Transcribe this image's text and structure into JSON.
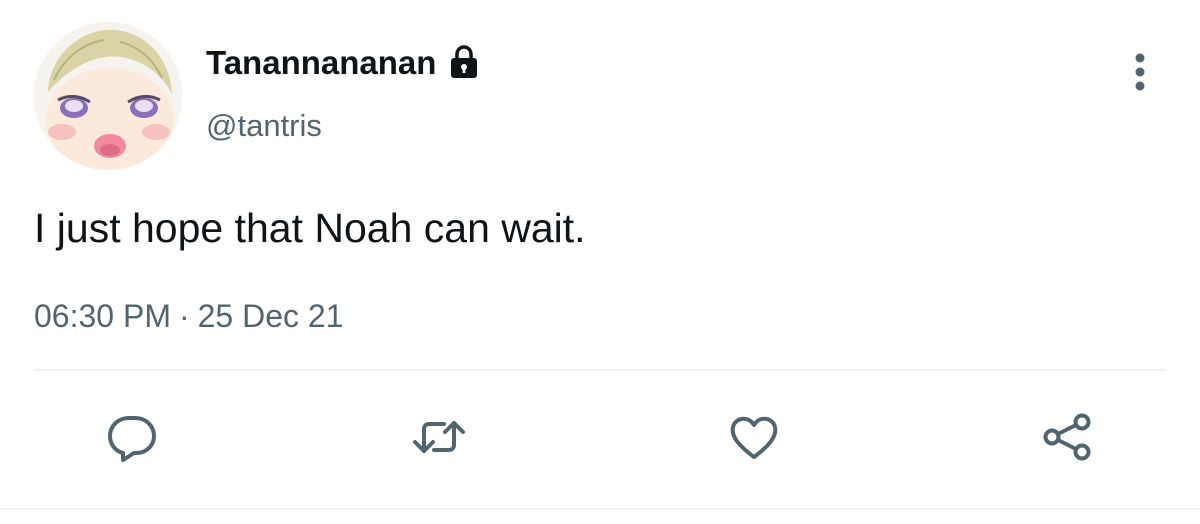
{
  "user": {
    "display_name": "Tanannananan",
    "handle": "@tantris",
    "protected_icon": "lock-icon",
    "avatar": "cartoon-character-avatar"
  },
  "tweet": {
    "text": "I just hope that Noah can wait.",
    "time": "06:30 PM",
    "separator": "·",
    "date": "25 Dec 21"
  },
  "actions": {
    "reply_icon": "reply-icon",
    "retweet_icon": "retweet-icon",
    "like_icon": "heart-icon",
    "share_icon": "share-icon"
  },
  "colors": {
    "text_primary": "#0f1419",
    "text_secondary": "#536471",
    "icon": "#536471",
    "divider": "#eff3f4"
  }
}
